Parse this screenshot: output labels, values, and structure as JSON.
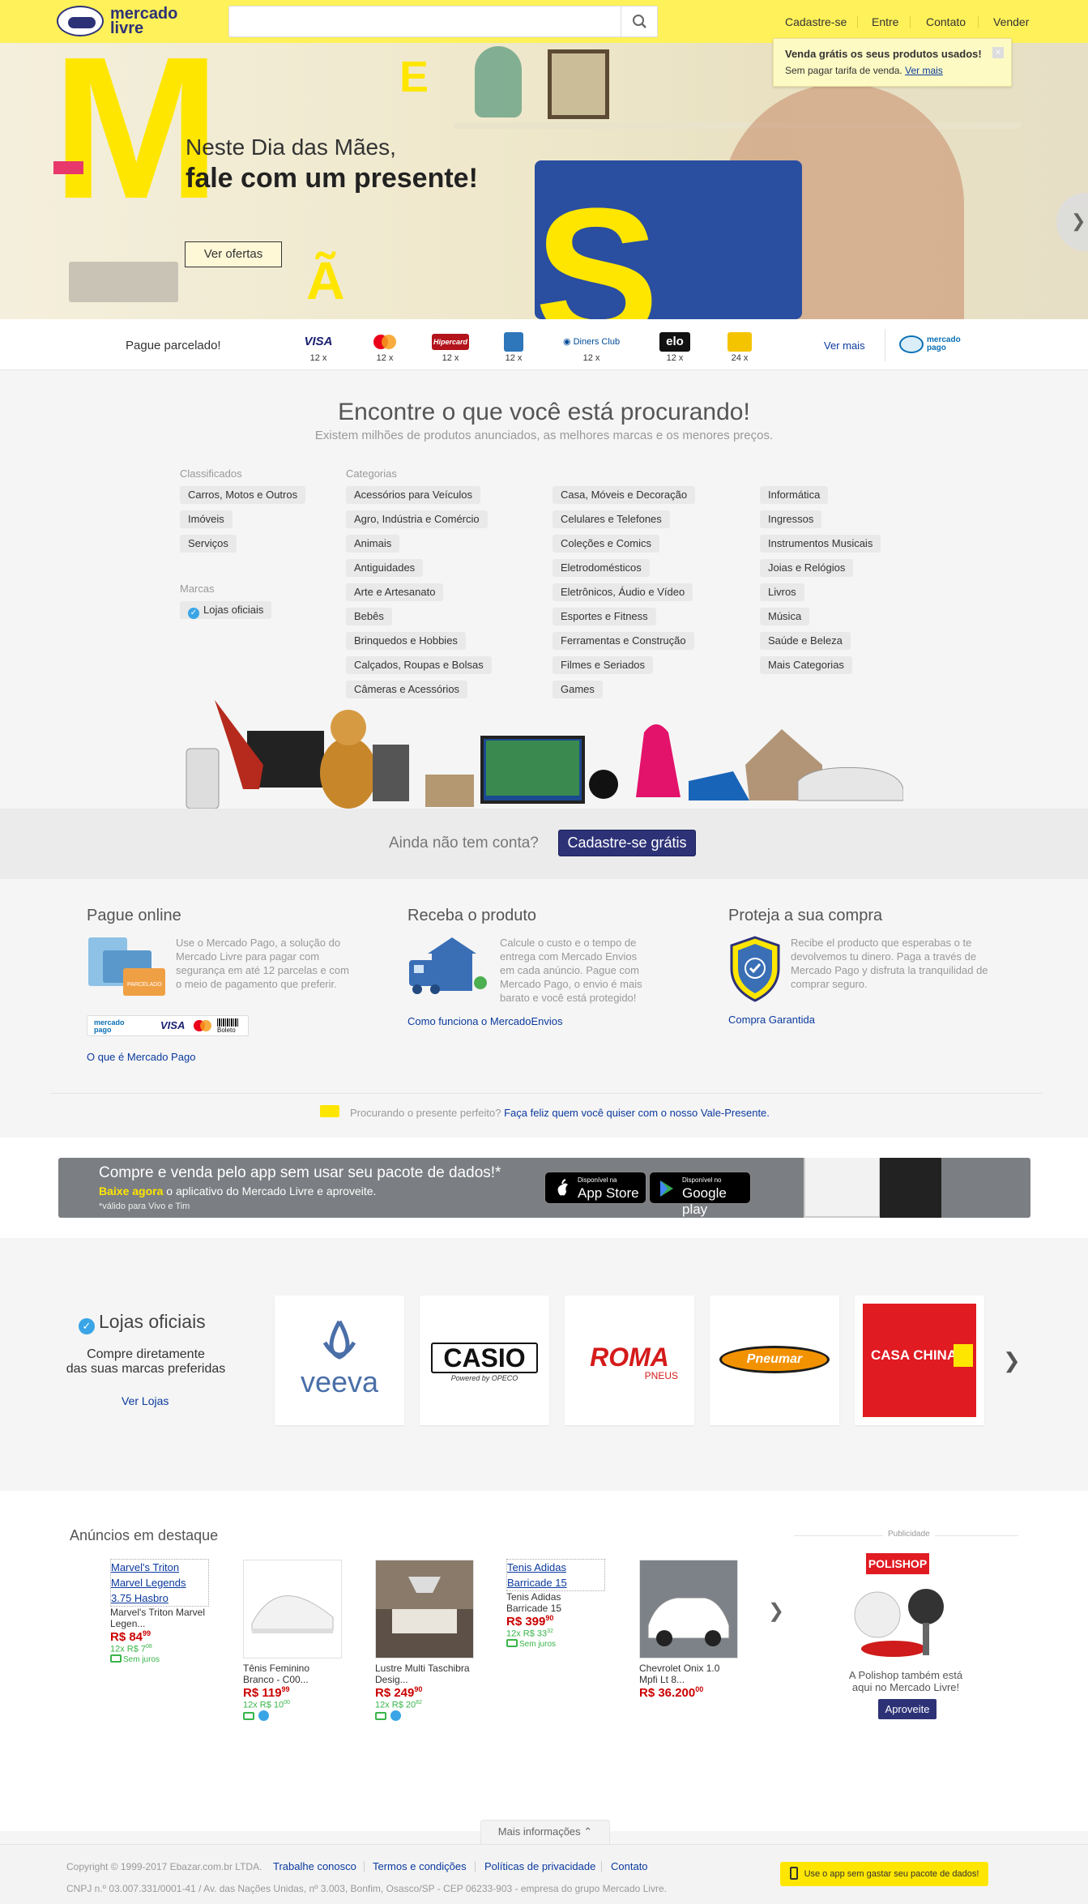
{
  "header": {
    "logo_line1": "mercado",
    "logo_line2": "livre",
    "search_placeholder": "",
    "nav": [
      "Cadastre-se",
      "Entre",
      "Contato",
      "Vender"
    ]
  },
  "tooltip": {
    "title": "Venda grátis os seus produtos usados!",
    "text": "Sem pagar tarifa de venda.",
    "link": "Ver mais"
  },
  "hero": {
    "letters": [
      "M",
      "E",
      "Ã",
      "S"
    ],
    "line1": "Neste Dia das Mães,",
    "line2": "fale com um presente!",
    "button": "Ver ofertas",
    "slide_count": 5,
    "active_slide": 1
  },
  "payment": {
    "label": "Pague parcelado!",
    "cards": [
      {
        "name": "VISA",
        "installments": "12 x",
        "color": "#1a1f71"
      },
      {
        "name": "Mastercard",
        "installments": "12 x",
        "color": "#eb001b"
      },
      {
        "name": "Hipercard",
        "installments": "12 x",
        "color": "#b3131b"
      },
      {
        "name": "AMEX",
        "installments": "12 x",
        "color": "#2e77bb"
      },
      {
        "name": "Diners Club",
        "installments": "12 x",
        "color": "#004a97"
      },
      {
        "name": "elo",
        "installments": "12 x",
        "color": "#000000"
      },
      {
        "name": "Credicard",
        "installments": "24 x",
        "color": "#f5c400"
      }
    ],
    "see_more": "Ver mais",
    "mp_line1": "mercado",
    "mp_line2": "pago"
  },
  "categories": {
    "title": "Encontre o que você está procurando!",
    "subtitle": "Existem milhões de produtos anunciados, as melhores marcas e os menores preços.",
    "classificados_label": "Classificados",
    "classificados": [
      "Carros, Motos e Outros",
      "Imóveis",
      "Serviços"
    ],
    "marcas_label": "Marcas",
    "marcas": [
      "Lojas oficiais"
    ],
    "categorias_label": "Categorias",
    "col1": [
      "Acessórios para Veículos",
      "Agro, Indústria e Comércio",
      "Animais",
      "Antiguidades",
      "Arte e Artesanato",
      "Bebês",
      "Brinquedos e Hobbies",
      "Calçados, Roupas e Bolsas",
      "Câmeras e Acessórios"
    ],
    "col2": [
      "Casa, Móveis e Decoração",
      "Celulares e Telefones",
      "Coleções e Comics",
      "Eletrodomésticos",
      "Eletrônicos, Áudio e Vídeo",
      "Esportes e Fitness",
      "Ferramentas e Construção",
      "Filmes e Seriados",
      "Games"
    ],
    "col3": [
      "Informática",
      "Ingressos",
      "Instrumentos Musicais",
      "Joias e Relógios",
      "Livros",
      "Música",
      "Saúde e Beleza",
      "Mais Categorias"
    ]
  },
  "signup": {
    "question": "Ainda não tem conta?",
    "button": "Cadastre-se grátis"
  },
  "benefits": [
    {
      "title": "Pague online",
      "text": "Use o Mercado Pago, a solução do Mercado Livre para pagar com segurança em até 12 parcelas e com o meio de pagamento que preferir.",
      "link": "O que é Mercado Pago",
      "logos": [
        "mercado pago",
        "VISA",
        "Mastercard",
        "Boleto"
      ],
      "card_label": "PARCELADO"
    },
    {
      "title": "Receba o produto",
      "text": "Calcule o custo e o tempo de entrega com Mercado Envios em cada anúncio. Pague com Mercado Pago, o envio é mais barato e você está protegido!",
      "link": "Como funciona o MercadoEnvios"
    },
    {
      "title": "Proteja a sua compra",
      "text": "Recibe el producto que esperabas o te devolvemos tu dinero. Paga a través de Mercado Pago y disfruta la tranquilidad de comprar seguro.",
      "link": "Compra Garantida"
    }
  ],
  "gift": {
    "text": "Procurando o presente perfeito?",
    "link": "Faça feliz quem você quiser com o nosso Vale-Presente."
  },
  "app_banner": {
    "title": "Compre e venda pelo app sem usar seu pacote de dados!*",
    "highlight": "Baixe agora",
    "text": "o aplicativo do Mercado Livre e aproveite.",
    "note": "*válido para Vivo e Tim",
    "appstore_small": "Disponível na",
    "appstore": "App Store",
    "gplay_small": "Disponível no",
    "gplay": "Google play"
  },
  "official": {
    "title": "Lojas oficiais",
    "subtitle1": "Compre diretamente",
    "subtitle2": "das suas marcas preferidas",
    "link": "Ver Lojas",
    "stores": [
      {
        "name": "veeva"
      },
      {
        "name": "CASIO",
        "sub": "Powered by OPECO"
      },
      {
        "name": "ROMA",
        "sub": "PNEUS"
      },
      {
        "name": "Pneumar"
      },
      {
        "name": "CASA CHINA"
      }
    ]
  },
  "featured": {
    "title": "Anúncios em destaque",
    "items": [
      {
        "link": "Marvel's Triton Marvel Legends 3.75 Hasbro",
        "desc": "Marvel's Triton Marvel Legen...",
        "price": "R$ 84",
        "cents": "99",
        "inst": "12x R$ 7",
        "inst_cents": "08",
        "free": "Sem juros"
      },
      {
        "desc": "Tênis Feminino Branco - C00...",
        "price": "R$ 119",
        "cents": "99",
        "inst": "12x R$ 10",
        "inst_cents": "00"
      },
      {
        "desc": "Lustre Multi Taschibra Desig...",
        "price": "R$ 249",
        "cents": "90",
        "inst": "12x R$ 20",
        "inst_cents": "82"
      },
      {
        "link": "Tenis Adidas Barricade 15",
        "desc": "Tenis Adidas Barricade 15",
        "price": "R$ 399",
        "cents": "90",
        "inst": "12x R$ 33",
        "inst_cents": "32",
        "free": "Sem juros"
      },
      {
        "desc": "Chevrolet Onix 1.0 Mpfi Lt 8...",
        "price": "R$ 36.200",
        "cents": "00"
      }
    ],
    "ad_label": "Publicidade",
    "ad_brand": "POLISHOP",
    "ad_text": "A Polishop também está aqui no Mercado Livre!",
    "ad_button": "Aproveite"
  },
  "footer": {
    "more": "Mais informações",
    "copyright": "Copyright © 1999-2017 Ebazar.com.br LTDA.",
    "links": [
      "Trabalhe conosco",
      "Termos e condições",
      "Políticas de privacidade",
      "Contato"
    ],
    "address": "CNPJ n.º 03.007.331/0001-41 / Av. das Nações Unidas, nº 3.003, Bonfim, Osasco/SP - CEP 06233-903 - empresa do grupo Mercado Livre.",
    "app_button": "Use o app sem gastar seu pacote de dados!"
  }
}
